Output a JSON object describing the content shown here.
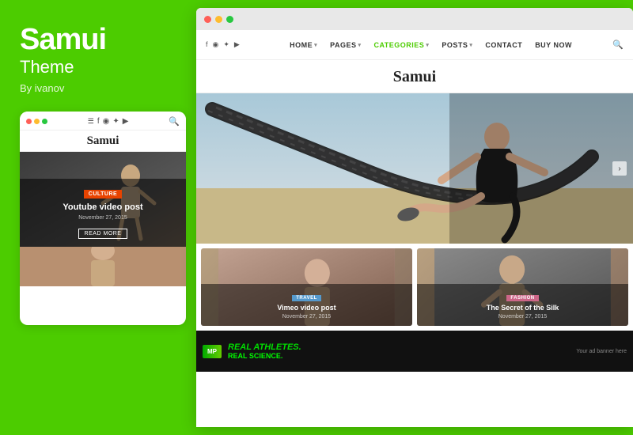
{
  "left": {
    "brand": "Samui",
    "theme": "Theme",
    "author": "By ivanov",
    "mobile": {
      "site_title": "Samui",
      "category": "CULTURE",
      "post_title": "Youtube video post",
      "post_date": "November 27, 2015",
      "read_more": "READ MORE"
    }
  },
  "browser": {
    "dots": [
      "#ff5f57",
      "#febc2e",
      "#28c840"
    ],
    "nav": {
      "social_icons": [
        "f",
        "ig",
        "tw",
        "yt"
      ],
      "items": [
        {
          "label": "HOME",
          "arrow": true
        },
        {
          "label": "PAGES",
          "arrow": true
        },
        {
          "label": "CATEGORIES",
          "arrow": true
        },
        {
          "label": "POSTS",
          "arrow": true
        },
        {
          "label": "CONTACT",
          "arrow": false
        },
        {
          "label": "BUY NOW",
          "arrow": false
        }
      ]
    },
    "site_title": "Samui",
    "hero_nav_arrow": "›",
    "grid": [
      {
        "category": "TRAVEL",
        "category_class": "travel",
        "title": "Vimeo video post",
        "date": "November 27, 2015"
      },
      {
        "category": "FASHION",
        "category_class": "fashion",
        "title": "The Secret of the Silk",
        "date": "November 27, 2015"
      }
    ],
    "ad": {
      "logo": "MP",
      "line1": "REAL ATHLETES.",
      "line2": "REAL SCIENCE.",
      "sidebar": "Your ad banner here"
    }
  }
}
